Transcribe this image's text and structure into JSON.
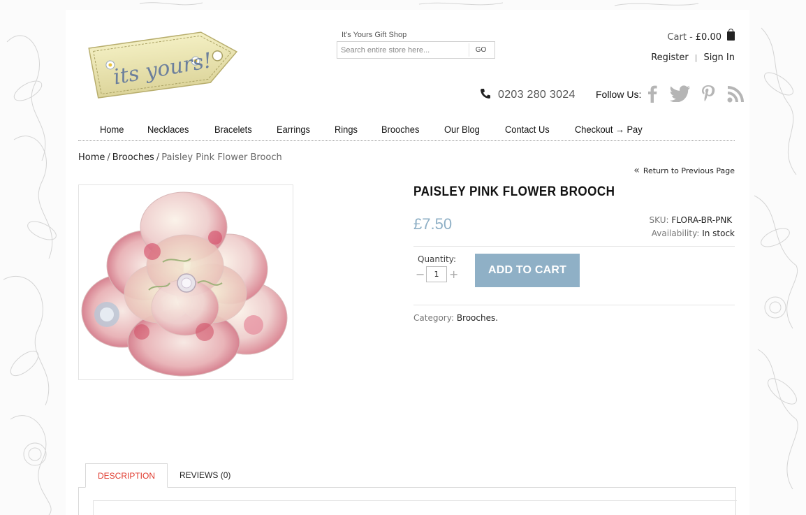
{
  "brand": {
    "logo_text": "its yours!",
    "shop_name": "It's Yours Gift Shop"
  },
  "search": {
    "placeholder": "Search entire store here...",
    "button_label": "GO"
  },
  "cart": {
    "label": "Cart -",
    "amount": "£0.00"
  },
  "account": {
    "register": "Register",
    "separator": "|",
    "sign_in": "Sign In"
  },
  "contact": {
    "phone": "0203 280 3024",
    "follow_label": "Follow Us:"
  },
  "socials": [
    "facebook-icon",
    "twitter-icon",
    "pinterest-icon",
    "rss-icon"
  ],
  "nav": {
    "items": [
      {
        "label": "Home"
      },
      {
        "label": "Necklaces"
      },
      {
        "label": "Bracelets"
      },
      {
        "label": "Earrings"
      },
      {
        "label": "Rings"
      },
      {
        "label": "Brooches"
      },
      {
        "label": "Our Blog"
      },
      {
        "label": "Contact Us"
      },
      {
        "label": "Checkout → Pay"
      }
    ]
  },
  "breadcrumb": {
    "home": "Home",
    "category": "Brooches",
    "current": "Paisley Pink Flower Brooch",
    "separator": "/"
  },
  "return_link": {
    "arrow": "«",
    "label": "Return to Previous Page"
  },
  "product": {
    "title": "PAISLEY PINK FLOWER BROOCH",
    "price": "£7.50",
    "sku_label": "SKU:",
    "sku": "FLORA-BR-PNK",
    "availability_label": "Availability:",
    "availability": "In stock",
    "quantity_label": "Quantity:",
    "quantity": "1",
    "minus": "−",
    "plus": "+",
    "add_to_cart": "ADD TO CART",
    "category_label": "Category:",
    "category": "Brooches."
  },
  "tabs": {
    "description": "DESCRIPTION",
    "reviews": "REVIEWS (0)"
  },
  "colors": {
    "accent": "#8fb0c6",
    "tab_active": "#e03b2f",
    "icon_grey": "#b5b5b5"
  }
}
